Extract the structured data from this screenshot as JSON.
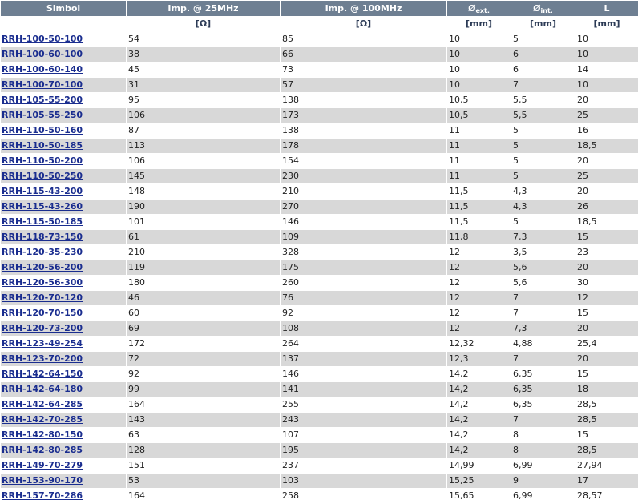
{
  "headers": {
    "simbol": "Simbol",
    "imp25": "Imp. @ 25MHz",
    "imp100": "Imp. @ 100MHz",
    "oext_sym": "Ø",
    "oext_sub": "ext.",
    "oint_sym": "Ø",
    "oint_sub": "int.",
    "len": "L"
  },
  "units": {
    "simbol": "",
    "imp25": "[Ω]",
    "imp100": "[Ω]",
    "oext": "[mm]",
    "oint": "[mm]",
    "len": "[mm]"
  },
  "rows": [
    {
      "sym": "RRH-100-50-100",
      "i25": "54",
      "i100": "85",
      "oe": "10",
      "oi": "5",
      "l": "10"
    },
    {
      "sym": "RRH-100-60-100",
      "i25": "38",
      "i100": "66",
      "oe": "10",
      "oi": "6",
      "l": "10"
    },
    {
      "sym": "RRH-100-60-140",
      "i25": "45",
      "i100": "73",
      "oe": "10",
      "oi": "6",
      "l": "14"
    },
    {
      "sym": "RRH-100-70-100",
      "i25": "31",
      "i100": "57",
      "oe": "10",
      "oi": "7",
      "l": "10"
    },
    {
      "sym": "RRH-105-55-200",
      "i25": "95",
      "i100": "138",
      "oe": "10,5",
      "oi": "5,5",
      "l": "20"
    },
    {
      "sym": "RRH-105-55-250",
      "i25": "106",
      "i100": "173",
      "oe": "10,5",
      "oi": "5,5",
      "l": "25"
    },
    {
      "sym": "RRH-110-50-160",
      "i25": "87",
      "i100": "138",
      "oe": "11",
      "oi": "5",
      "l": "16"
    },
    {
      "sym": "RRH-110-50-185",
      "i25": "113",
      "i100": "178",
      "oe": "11",
      "oi": "5",
      "l": "18,5"
    },
    {
      "sym": "RRH-110-50-200",
      "i25": "106",
      "i100": "154",
      "oe": "11",
      "oi": "5",
      "l": "20"
    },
    {
      "sym": "RRH-110-50-250",
      "i25": "145",
      "i100": "230",
      "oe": "11",
      "oi": "5",
      "l": "25"
    },
    {
      "sym": "RRH-115-43-200",
      "i25": "148",
      "i100": "210",
      "oe": "11,5",
      "oi": "4,3",
      "l": "20"
    },
    {
      "sym": "RRH-115-43-260",
      "i25": "190",
      "i100": "270",
      "oe": "11,5",
      "oi": "4,3",
      "l": "26"
    },
    {
      "sym": "RRH-115-50-185",
      "i25": "101",
      "i100": "146",
      "oe": "11,5",
      "oi": "5",
      "l": "18,5"
    },
    {
      "sym": "RRH-118-73-150",
      "i25": "61",
      "i100": "109",
      "oe": "11,8",
      "oi": "7,3",
      "l": "15"
    },
    {
      "sym": "RRH-120-35-230",
      "i25": "210",
      "i100": "328",
      "oe": "12",
      "oi": "3,5",
      "l": "23"
    },
    {
      "sym": "RRH-120-56-200",
      "i25": "119",
      "i100": "175",
      "oe": "12",
      "oi": "5,6",
      "l": "20"
    },
    {
      "sym": "RRH-120-56-300",
      "i25": "180",
      "i100": "260",
      "oe": "12",
      "oi": "5,6",
      "l": "30"
    },
    {
      "sym": "RRH-120-70-120",
      "i25": "46",
      "i100": "76",
      "oe": "12",
      "oi": "7",
      "l": "12"
    },
    {
      "sym": "RRH-120-70-150",
      "i25": "60",
      "i100": "92",
      "oe": "12",
      "oi": "7",
      "l": "15"
    },
    {
      "sym": "RRH-120-73-200",
      "i25": "69",
      "i100": "108",
      "oe": "12",
      "oi": "7,3",
      "l": "20"
    },
    {
      "sym": "RRH-123-49-254",
      "i25": "172",
      "i100": "264",
      "oe": "12,32",
      "oi": "4,88",
      "l": "25,4"
    },
    {
      "sym": "RRH-123-70-200",
      "i25": "72",
      "i100": "137",
      "oe": "12,3",
      "oi": "7",
      "l": "20"
    },
    {
      "sym": "RRH-142-64-150",
      "i25": "92",
      "i100": "146",
      "oe": "14,2",
      "oi": "6,35",
      "l": "15"
    },
    {
      "sym": "RRH-142-64-180",
      "i25": "99",
      "i100": "141",
      "oe": "14,2",
      "oi": "6,35",
      "l": "18"
    },
    {
      "sym": "RRH-142-64-285",
      "i25": "164",
      "i100": "255",
      "oe": "14,2",
      "oi": "6,35",
      "l": "28,5"
    },
    {
      "sym": "RRH-142-70-285",
      "i25": "143",
      "i100": "243",
      "oe": "14,2",
      "oi": "7",
      "l": "28,5"
    },
    {
      "sym": "RRH-142-80-150",
      "i25": "63",
      "i100": "107",
      "oe": "14,2",
      "oi": "8",
      "l": "15"
    },
    {
      "sym": "RRH-142-80-285",
      "i25": "128",
      "i100": "195",
      "oe": "14,2",
      "oi": "8",
      "l": "28,5"
    },
    {
      "sym": "RRH-149-70-279",
      "i25": "151",
      "i100": "237",
      "oe": "14,99",
      "oi": "6,99",
      "l": "27,94"
    },
    {
      "sym": "RRH-153-90-170",
      "i25": "53",
      "i100": "103",
      "oe": "15,25",
      "oi": "9",
      "l": "17"
    },
    {
      "sym": "RRH-157-70-286",
      "i25": "164",
      "i100": "258",
      "oe": "15,65",
      "oi": "6,99",
      "l": "28,57"
    }
  ],
  "colors": {
    "header_bg": "#6e7f92",
    "row_alt": "#d8d8d8",
    "link": "#1a2d8f"
  }
}
